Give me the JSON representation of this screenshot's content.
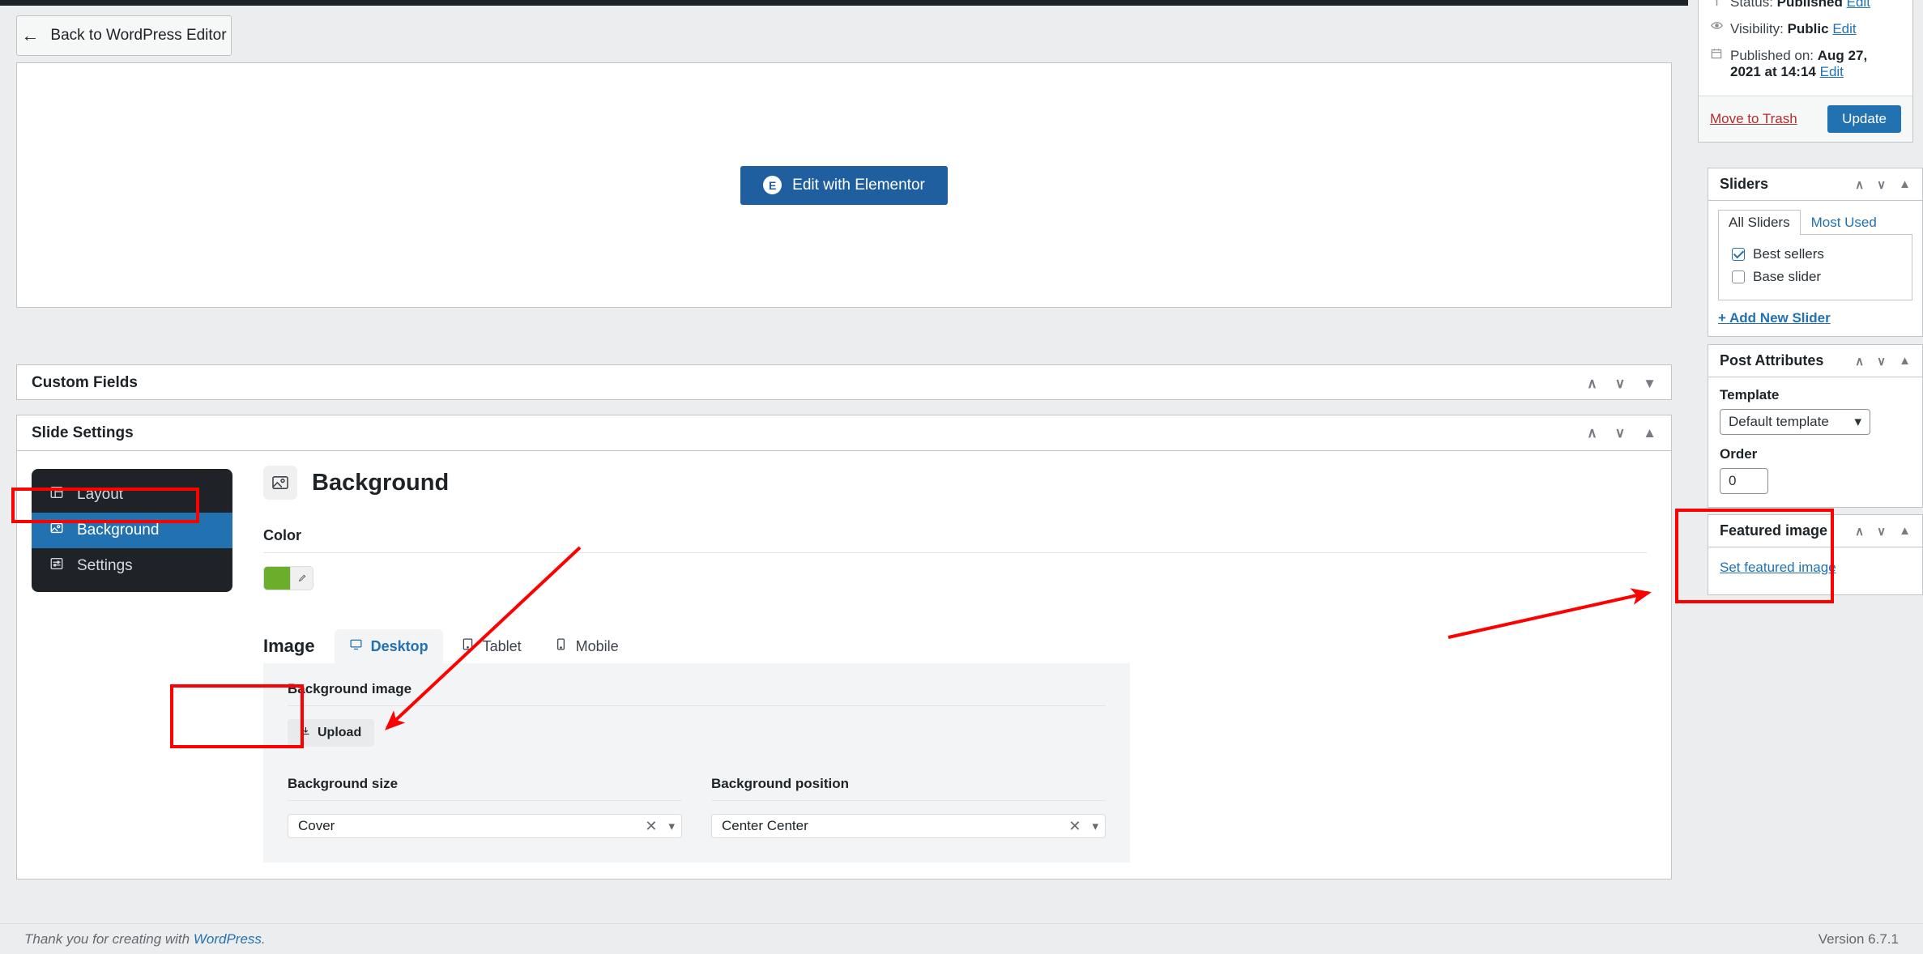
{
  "colors": {
    "accent": "#2271b1",
    "elementor_button": "#1f5fa0",
    "background_color_swatch": "#6aae2c",
    "annotation_red": "#ff0000",
    "dark_rail": "#1f2327",
    "trash_red": "#b32d2e"
  },
  "topbar": {
    "back_button_label": "Back to WordPress Editor",
    "back_arrow_icon": "arrow-left-icon"
  },
  "editor_panel": {
    "elementor_button_label": "Edit with Elementor",
    "elementor_logo_glyph": "E"
  },
  "metaboxes": {
    "custom_fields": {
      "title": "Custom Fields",
      "ctrl_up": "∧",
      "ctrl_down": "∨",
      "ctrl_toggle": "▼"
    },
    "slide_settings": {
      "title": "Slide Settings",
      "ctrl_up": "∧",
      "ctrl_down": "∨",
      "ctrl_toggle": "▲"
    }
  },
  "slide_settings": {
    "tabs": [
      {
        "label": "Layout",
        "icon": "layout-icon",
        "active": false
      },
      {
        "label": "Background",
        "icon": "image-icon",
        "active": true
      },
      {
        "label": "Settings",
        "icon": "sliders-icon",
        "active": false
      }
    ],
    "panel_title": "Background",
    "panel_icon": "image-icon",
    "color": {
      "label": "Color",
      "swatch_value": "#6aae2c",
      "picker_icon": "brush-icon"
    },
    "image": {
      "label": "Image",
      "device_tabs": [
        {
          "label": "Desktop",
          "icon": "desktop-icon",
          "active": true
        },
        {
          "label": "Tablet",
          "icon": "tablet-icon",
          "active": false
        },
        {
          "label": "Mobile",
          "icon": "mobile-icon",
          "active": false
        }
      ],
      "background_image_label": "Background image",
      "upload_label": "Upload",
      "upload_icon": "download-icon",
      "background_size_label": "Background size",
      "background_size_value": "Cover",
      "background_position_label": "Background position",
      "background_position_value": "Center Center",
      "clear_icon": "close-icon",
      "chevron_icon": "chevron-down-icon"
    }
  },
  "sidebar": {
    "publish": {
      "status_label": "Status:",
      "status_value": "Published",
      "status_edit": "Edit",
      "status_icon": "pin-icon",
      "visibility_label": "Visibility:",
      "visibility_value": "Public",
      "visibility_edit": "Edit",
      "visibility_icon": "eye-icon",
      "published_label": "Published on:",
      "published_value": "Aug 27, 2021 at 14:14",
      "published_edit": "Edit",
      "published_icon": "calendar-icon",
      "trash_label": "Move to Trash",
      "update_label": "Update"
    },
    "sliders": {
      "title": "Sliders",
      "ctrl_up": "∧",
      "ctrl_down": "∨",
      "ctrl_toggle": "▲",
      "tabs": [
        {
          "label": "All Sliders",
          "active": true
        },
        {
          "label": "Most Used",
          "active": false
        }
      ],
      "items": [
        {
          "label": "Best sellers",
          "checked": true
        },
        {
          "label": "Base slider",
          "checked": false
        }
      ],
      "add_new_label": "+ Add New Slider"
    },
    "post_attributes": {
      "title": "Post Attributes",
      "ctrl_up": "∧",
      "ctrl_down": "∨",
      "ctrl_toggle": "▲",
      "template_label": "Template",
      "template_value": "Default template",
      "order_label": "Order",
      "order_value": "0"
    },
    "featured_image": {
      "title": "Featured image",
      "ctrl_up": "∧",
      "ctrl_down": "∨",
      "ctrl_toggle": "▲",
      "set_link_label": "Set featured image"
    }
  },
  "footer": {
    "thanks_prefix": "Thank you for creating with ",
    "thanks_link": "WordPress",
    "thanks_suffix": ".",
    "version": "Version 6.7.1"
  }
}
